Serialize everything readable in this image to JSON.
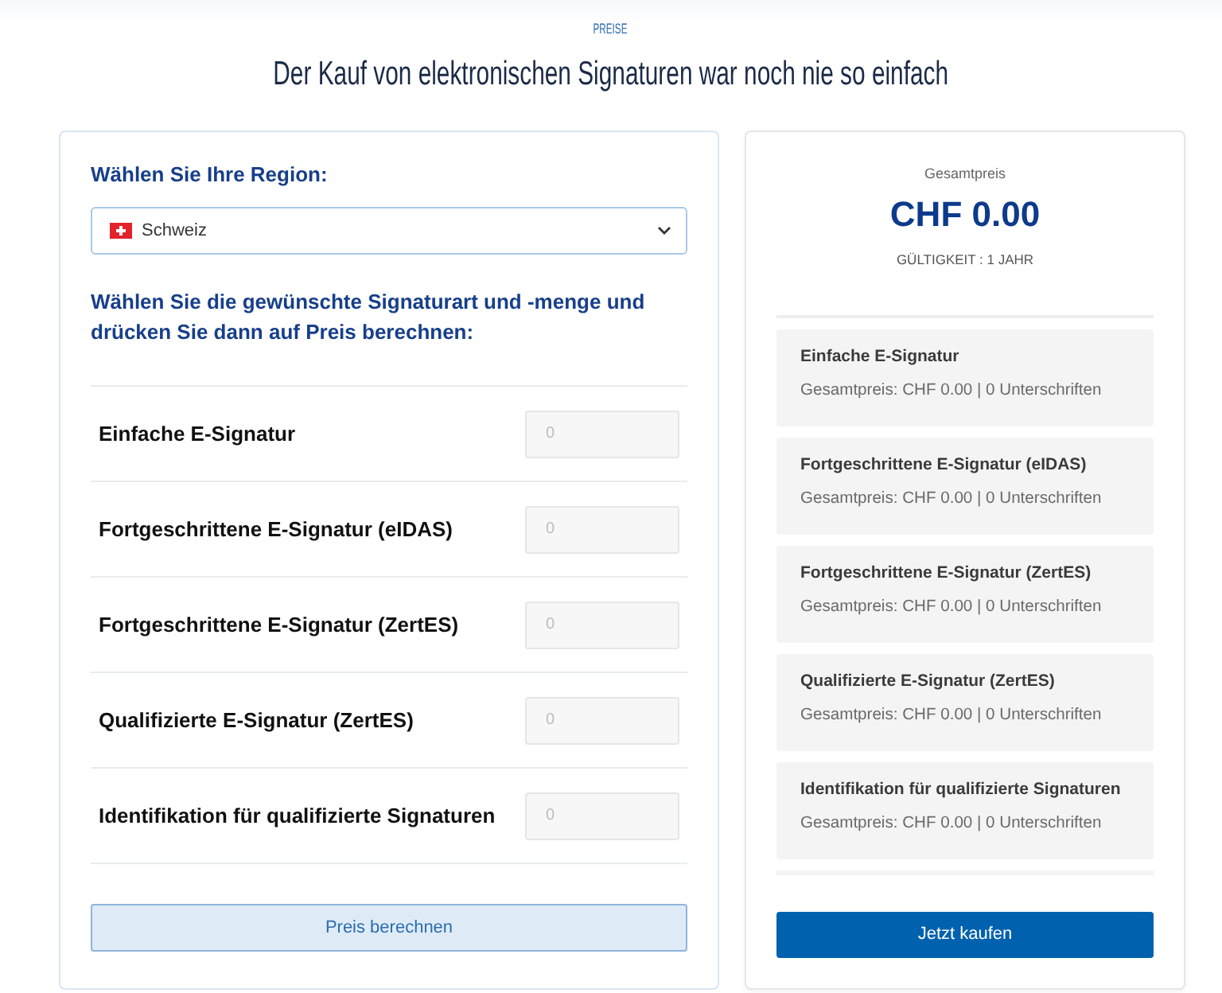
{
  "section_label": "PREISE",
  "title": "Der Kauf von elektronischen Signaturen war noch nie so einfach",
  "configurator": {
    "region_label": "Wählen Sie Ihre Region:",
    "region_select": {
      "value": "Schweiz"
    },
    "instructions": "Wählen Sie die gewünschte Signaturart und -menge und drücken Sie dann auf Preis berechnen:",
    "signature_types": [
      {
        "label": "Einfache E-Signatur",
        "placeholder": "0"
      },
      {
        "label": "Fortgeschrittene E-Signatur (eIDAS)",
        "placeholder": "0"
      },
      {
        "label": "Fortgeschrittene E-Signatur (ZertES)",
        "placeholder": "0"
      },
      {
        "label": "Qualifizierte E-Signatur (ZertES)",
        "placeholder": "0"
      },
      {
        "label": "Identifikation für qualifizierte Signaturen",
        "placeholder": "0"
      }
    ],
    "calculate_button": "Preis berechnen"
  },
  "summary": {
    "total_label": "Gesamtpreis",
    "total": "CHF 0.00",
    "validity": "GÜLTIGKEIT : 1 JAHR",
    "items": [
      {
        "name": "Einfache E-Signatur",
        "detail": "Gesamtpreis: CHF 0.00 | 0 Unterschriften"
      },
      {
        "name": "Fortgeschrittene E-Signatur (eIDAS)",
        "detail": "Gesamtpreis: CHF 0.00 | 0 Unterschriften"
      },
      {
        "name": "Fortgeschrittene E-Signatur (ZertES)",
        "detail": "Gesamtpreis: CHF 0.00 | 0 Unterschriften"
      },
      {
        "name": "Qualifizierte E-Signatur (ZertES)",
        "detail": "Gesamtpreis: CHF 0.00 | 0 Unterschriften"
      },
      {
        "name": "Identifikation für qualifizierte Signaturen",
        "detail": "Gesamtpreis: CHF 0.00 | 0 Unterschriften"
      }
    ],
    "buy_button": "Jetzt kaufen"
  }
}
